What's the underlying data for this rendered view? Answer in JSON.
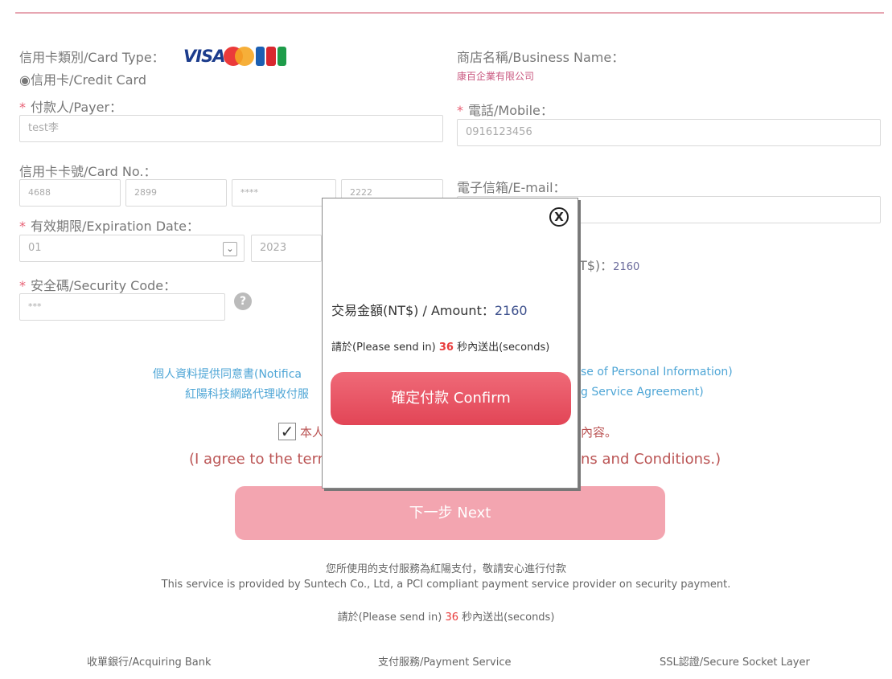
{
  "form": {
    "card_type_label": "信用卡類別/Card Type：",
    "card_type_value": "◉信用卡/Credit Card",
    "card_logos": {
      "visa": "VISA",
      "mastercard_icon": "mastercard-icon",
      "jcb_icon": "jcb-icon"
    },
    "payer_label": "付款人/Payer：",
    "payer_value": "test李",
    "card_no_label": "信用卡卡號/Card No.：",
    "card_no": [
      "4688",
      "2899",
      "****",
      "2222"
    ],
    "expiry_label": "有效期限/Expiration Date：",
    "expiry_month": "01",
    "expiry_year": "2023",
    "security_label": "安全碼/Security Code：",
    "security_value": "***",
    "business_label": "商店名稱/Business Name：",
    "business_value": "康百企業有限公司",
    "mobile_label": "電話/Mobile：",
    "mobile_value": "0916123456",
    "email_label": "電子信箱/E-mail：",
    "email_value": "",
    "amount_label_partial": "NT$)：",
    "amount_value": "2160",
    "required_mark": "*"
  },
  "agreements": {
    "line1_left": "個人資料提供同意書(Notifica",
    "line1_right": "se of Personal Information)",
    "line2_left": "紅陽科技網路代理收付服",
    "line2_right": "g Service Agreement)",
    "checkbox_glyph": "✓",
    "agree_cn_left": "本人",
    "agree_cn_right": "內容。",
    "agree_en_left": "(I agree to the term",
    "agree_en_right": "ns and Conditions.)"
  },
  "next_button": "下一步 Next",
  "footer": {
    "cn": "您所使用的支付服務為紅陽支付，敬請安心進行付款",
    "en": "This service is provided by Suntech Co., Ltd, a PCI compliant payment service provider on security payment.",
    "countdown_prefix": "請於(Please send in)",
    "countdown_value": "36",
    "countdown_suffix": "秒內送出(seconds)",
    "acquiring_bank": "收單銀行/Acquiring Bank",
    "payment_service": "支付服務/Payment Service",
    "ssl": "SSL認證/Secure Socket Layer"
  },
  "modal": {
    "close_glyph": "X",
    "amount_label": "交易金額(NT$) / Amount：",
    "amount_value": "2160",
    "countdown_prefix": "請於(Please send in)",
    "countdown_value": "36",
    "countdown_suffix": "秒內送出(seconds)",
    "confirm_label": "確定付款 Confirm"
  },
  "colors": {
    "accent_pink": "#f3a5b0",
    "confirm_red": "#e24556",
    "link_blue": "#4fa6d6",
    "countdown_red": "#e83b3b"
  }
}
